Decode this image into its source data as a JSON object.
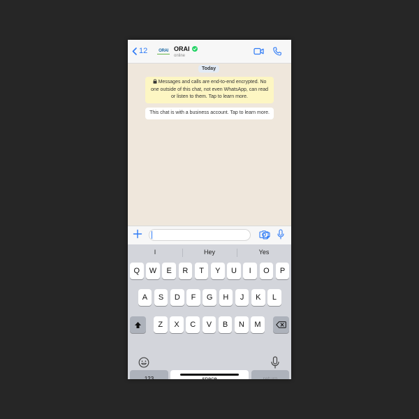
{
  "header": {
    "back_count": "12",
    "logo_text": "ORAI",
    "contact_name": "ORAI",
    "status": "online"
  },
  "chat": {
    "date_label": "Today",
    "encryption_note": "Messages and calls are end-to-end encrypted. No one outside of this chat, not even WhatsApp, can read or listen to them. Tap to learn more.",
    "business_note": "This chat is with a business account. Tap to learn more."
  },
  "keyboard": {
    "suggestions": [
      "I",
      "Hey",
      "Yes"
    ],
    "row1": [
      "Q",
      "W",
      "E",
      "R",
      "T",
      "Y",
      "U",
      "I",
      "O",
      "P"
    ],
    "row2": [
      "A",
      "S",
      "D",
      "F",
      "G",
      "H",
      "J",
      "K",
      "L"
    ],
    "row3": [
      "Z",
      "X",
      "C",
      "V",
      "B",
      "N",
      "M"
    ],
    "numbers_label": "123",
    "space_label": "space",
    "return_label": "return"
  },
  "colors": {
    "accent": "#2f7bf6",
    "verified": "#25d366",
    "encryption_bg": "#fdf6c3",
    "keyboard_bg": "#d3d5db"
  }
}
